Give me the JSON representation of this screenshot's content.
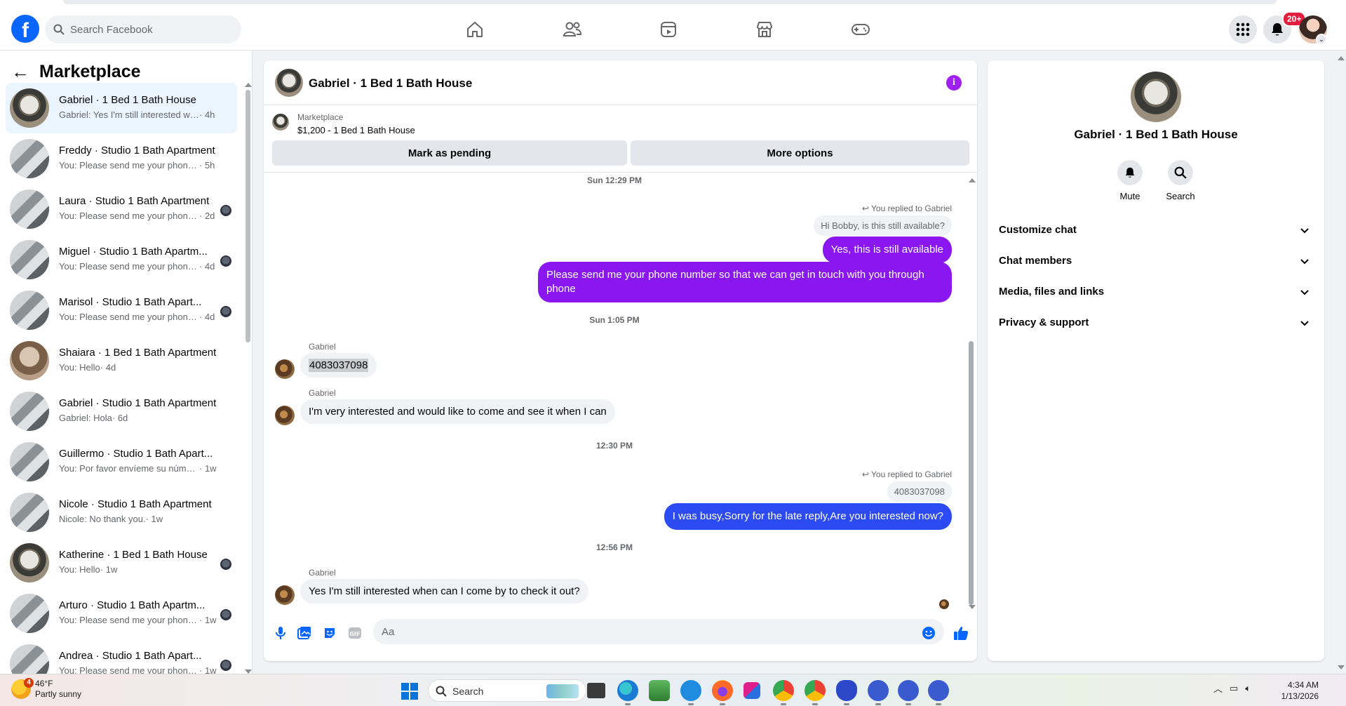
{
  "header": {
    "logo": "f",
    "search_placeholder": "Search Facebook",
    "notif_count": "20+",
    "icons": [
      "home-icon",
      "friends-icon",
      "video-icon",
      "marketplace-icon",
      "gaming-icon",
      "menu-grid-icon",
      "bell-icon"
    ]
  },
  "sidebar": {
    "title": "Marketplace",
    "conversations": [
      {
        "title": "Gabriel · 1 Bed 1 Bath House",
        "preview": "Gabriel: Yes I'm still interested whe...",
        "time": "· 4h"
      },
      {
        "title": "Freddy · Studio 1 Bath Apartment",
        "preview": "You: Please send me your phone nu...",
        "time": "· 5h"
      },
      {
        "title": "Laura · Studio 1 Bath Apartment",
        "preview": "You: Please send me your phone...",
        "time": "· 2d"
      },
      {
        "title": "Miguel · Studio 1 Bath Apartm...",
        "preview": "You: Please send me your phone...",
        "time": "· 4d"
      },
      {
        "title": "Marisol · Studio 1 Bath Apart...",
        "preview": "You: Please send me your phone...",
        "time": "· 4d"
      },
      {
        "title": "Shaiara · 1 Bed 1 Bath Apartment",
        "preview": "You: Hello",
        "time": "· 4d"
      },
      {
        "title": "Gabriel · Studio 1 Bath Apartment",
        "preview": "Gabriel: Hola",
        "time": "· 6d"
      },
      {
        "title": "Guillermo · Studio 1 Bath Apart...",
        "preview": "You: Por favor envíeme su número ...",
        "time": "· 1w"
      },
      {
        "title": "Nicole · Studio 1 Bath Apartment",
        "preview": "Nicole: No thank you.",
        "time": "· 1w"
      },
      {
        "title": "Katherine · 1 Bed 1 Bath House",
        "preview": "You: Hello",
        "time": "· 1w"
      },
      {
        "title": "Arturo · Studio 1 Bath Apartm...",
        "preview": "You: Please send me your phone...",
        "time": "· 1w"
      },
      {
        "title": "Andrea · Studio 1 Bath Apart...",
        "preview": "You: Please send me your phone...",
        "time": "· 1w"
      }
    ]
  },
  "chat": {
    "name": "Gabriel · 1 Bed 1 Bath House",
    "listing_source": "Marketplace",
    "listing_title": "$1,200 - 1 Bed 1 Bath House",
    "btn_pending": "Mark as pending",
    "btn_more": "More options",
    "ts1": "Sun 12:29 PM",
    "replied_label": "You replied to Gabriel",
    "quote1": "Hi Bobby, is this still available?",
    "out1": "Yes, this is still available",
    "out2": "Please send me your phone  number so that we can get in touch with you through phone",
    "ts2": "Sun 1:05 PM",
    "sender": "Gabriel",
    "in1": "4083037098",
    "in2": "I'm very interested and would like to come and see it when I can",
    "ts3": "12:30 PM",
    "quote2": "4083037098",
    "out3": "I was busy,Sorry for the late reply,Are you interested now?",
    "ts4": "12:56 PM",
    "in3": "Yes I'm still interested when can I come by to check it out?",
    "input_placeholder": "Aa"
  },
  "info": {
    "name": "Gabriel · 1 Bed 1 Bath House",
    "mute_label": "Mute",
    "search_label": "Search",
    "sections": [
      "Customize chat",
      "Chat members",
      "Media, files and links",
      "Privacy & support"
    ]
  },
  "taskbar": {
    "temp": "46°F",
    "weather": "Partly sunny",
    "weather_badge": "4",
    "search_label": "Search",
    "time": "4:34 AM",
    "date": "1/13/2026"
  },
  "colors": {
    "brand": "#0866ff",
    "bubble_purple": "#8a16f0",
    "bubble_blue": "#2c4bf5",
    "info_icon": "#a020f0"
  }
}
